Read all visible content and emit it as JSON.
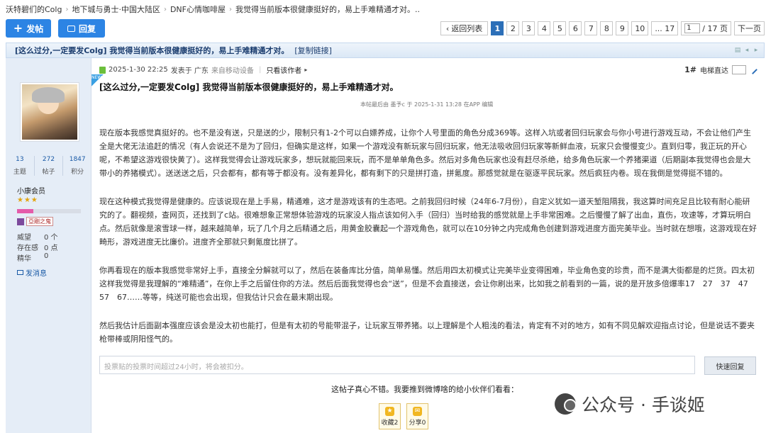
{
  "breadcrumb": [
    "沃特碧们的Colg",
    "地下城与勇士·中国大陆区",
    "DNF心情咖啡屋",
    "我觉得当前版本很健康挺好的，易上手难精通才对。.."
  ],
  "toolbar": {
    "post_label": "发帖",
    "reply_label": "回复"
  },
  "pager": {
    "back_label": "返回列表",
    "pages": [
      "1",
      "2",
      "3",
      "4",
      "5",
      "6",
      "7",
      "8",
      "9",
      "10",
      "... 17"
    ],
    "current": "1",
    "total_label": "/ 17 页",
    "next_label": "下一页"
  },
  "thread": {
    "title": "[这么过分,一定要发Colg] 我觉得当前版本很健康挺好的，易上手难精通才对。",
    "copy_label": "[复制链接]"
  },
  "profile": {
    "stats": [
      {
        "value": "13",
        "label": "主题"
      },
      {
        "value": "272",
        "label": "帖子"
      },
      {
        "value": "1847",
        "label": "积分"
      }
    ],
    "rank": "小康会员",
    "stars": "★★★",
    "progress": 0.25,
    "medal_text": "亞剛之鬼",
    "info": [
      {
        "key": "威望",
        "value": "0 个"
      },
      {
        "key": "存在感",
        "value": "0 点"
      },
      {
        "key": "精华",
        "value": "0"
      }
    ],
    "message_label": "发消息"
  },
  "post": {
    "new_tag": "NEW",
    "datetime": "2025-1-30 22:25",
    "posted_in": "发表于 广东",
    "from_device": "来自移动设备",
    "only_author": "只看该作者",
    "floor_num": "1#",
    "floor_label": "电梯直达",
    "title": "[这么过分,一定要发Colg] 我觉得当前版本很健康挺好的，易上手难精通才对。",
    "edit_note": "本帖最后由 墨予c 于 2025-1-31 13:28 在APP 编辑",
    "paragraphs": [
      "现在版本我感觉真挺好的。也不是没有送，只是送的少，限制只有1-2个可以白嫖养成，让你个人号里面的角色分成369等。这样入坑或者回归玩家会与你小号进行游戏互动，不会让他们产生全是大佬无法追赶的情况（有人会说还不是为了回归，但确实是这样，如果一个游戏没有新玩家与回归玩家，他无法吸收回归玩家等新鲜血液，玩家只会慢慢变少。直到归零，我正玩的开心呢，不希望这游戏很快黄了）。这样我觉得会让游戏玩家多，想玩就能回来玩，而不是单单角色多。然后对多角色玩家也没有赶尽杀绝，给多角色玩家一个养猪渠道（后期副本我觉得也会是大带小的养猪模式）。送送送之后，只会都有，都有等于都没有。没有差异化，都有剩下的只是拼打造，拼氪度。那感觉就是在驱逐平民玩家。然后疯狂内卷。现在我倒是觉得挺不错的。",
      "现在这种模式我觉得是健康的。应该说现在是上手易，精通难，这才是游戏该有的生态吧。之前我回归时候（24年6-7月份），自定义犹如一道天堑阻隔我，我这算时间充足且比较有耐心能研究的了。翻视频，查网页，还找到了c站。很难想象正常想体验游戏的玩家没人指点该如何入手（回归）当时给我的感觉就是上手非常困难。之后慢慢了解了出血，直伤，攻速等，才算玩明白点。然后就像是滚雪球一样，越来越简单，玩了几个月之后精通之后，用黄金胶囊起一个游戏角色，就可以在10分钟之内完成角色创建到游戏进度方面完美毕业。当时就在想哦，这游戏现在好畸形，游戏进度无比廉价。进度齐全那就只剩氪度比拼了。",
      "你再看现在的版本我感觉非常好上手，直接全分解就可以了，然后在装备库比分值，简单易懂。然后用四太初模式让完美毕业变得困难，毕业角色变的珍贵，而不是满大街都是的烂货。四太初这样我觉得是我理解的“难精通”，在你上手之后留住你的方法。然后后面我觉得也会“送”，但是不会直接送，会让你刷出来，比如我之前看到的一篇，说的是开放多倍爆率17　27　37　47　57　67……等等，纯送可能也会出现，但我估计只会在最末期出现。",
      "然后我估计后面副本强度应该会是没太初也能打，但是有太初的号能带混子，让玩家互带养猪。以上理解是个人粗浅的看法，肯定有不对的地方，如有不同见解欢迎指点讨论，但是说话不要夹枪带棒或阴阳怪气的。"
    ]
  },
  "reply": {
    "placeholder": "投票贴的投票时间超过24小时，将会被扣分。",
    "quick_label": "快速回复"
  },
  "share": {
    "prompt": "这帖子真心不错。我要推到微博啥的给小伙伴们看看：",
    "fav_label": "收藏2",
    "share_label": "分享0"
  },
  "watermark": {
    "text": "公众号 · 手谈姬"
  },
  "colors": {
    "accent": "#2c84e4",
    "header_bg": "#dbe8f6",
    "sidebar_bg": "#e5edf7",
    "link": "#1a5aa6",
    "progress": "#e45caa"
  },
  "icons": {
    "post": "plus-icon",
    "reply": "reply-icon",
    "back": "chevron-left-icon",
    "print": "print-icon",
    "device": "mobile-icon",
    "message": "envelope-icon",
    "jump": "pen-icon",
    "fav": "star-icon",
    "share": "share-icon"
  }
}
